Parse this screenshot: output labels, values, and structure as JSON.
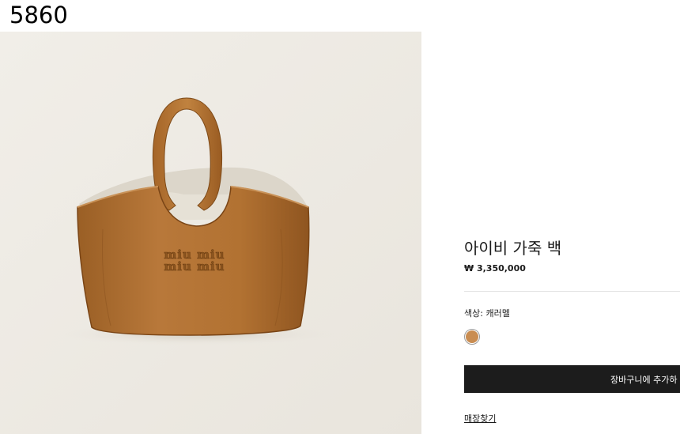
{
  "overlay": {
    "id_text": "5860"
  },
  "product": {
    "name": "아이비 가죽 백",
    "price": "₩ 3,350,000",
    "image_logo_text": "miu miu",
    "color": {
      "label": "색상:",
      "value": "캐러멜",
      "swatch_hex": "#c98d52"
    },
    "add_to_cart_label": "장바구니에 추가하",
    "store_link_label": "매장찾기"
  },
  "colors": {
    "image_background": "#efece5",
    "bag_leather": "#b0712f",
    "button_background": "#1c1c1c"
  }
}
